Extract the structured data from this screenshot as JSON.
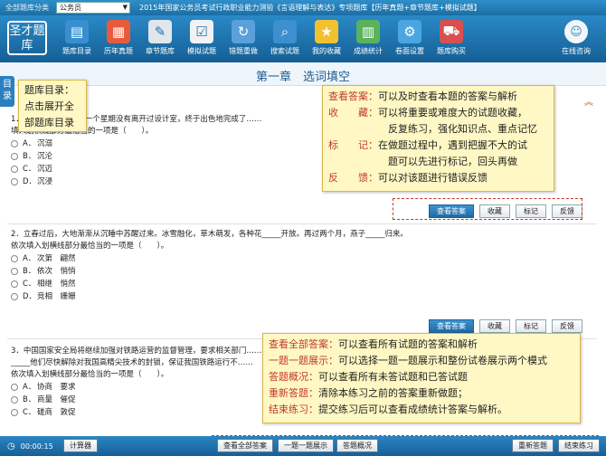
{
  "topbar": {
    "category_label": "全部题库分类",
    "category_value": "公务员",
    "title": "2015年国家公务员考试行政职业能力测验《言语理解与表达》专项题库【历年真题+章节题库+模拟试题】"
  },
  "logo": {
    "text": "圣才题库"
  },
  "toolbar": {
    "items": [
      {
        "label": "题库目录",
        "icon": "catalog-icon",
        "color": "#3a8fd0"
      },
      {
        "label": "历年真题",
        "icon": "calendar-icon",
        "color": "#e85b3a"
      },
      {
        "label": "章节题库",
        "icon": "notebook-icon",
        "color": "#e0e6ec"
      },
      {
        "label": "模拟试题",
        "icon": "checklist-icon",
        "color": "#f0f2f4"
      },
      {
        "label": "错题重做",
        "icon": "redo-icon",
        "color": "#5aa0da"
      },
      {
        "label": "搜索试题",
        "icon": "search-icon",
        "color": "#3e8fcf"
      },
      {
        "label": "我的收藏",
        "icon": "star-icon",
        "color": "#f2c12e"
      },
      {
        "label": "成绩统计",
        "icon": "stats-icon",
        "color": "#5ab25a"
      },
      {
        "label": "卷面设置",
        "icon": "gear-icon",
        "color": "#4aa6e0"
      },
      {
        "label": "题库购买",
        "icon": "cart-icon",
        "color": "#d94f4f"
      }
    ],
    "online": {
      "label": "在线咨询",
      "icon": "chat-icon"
    }
  },
  "chapter": {
    "title": "第一章　选词填空",
    "directory_tab": "目录"
  },
  "questions": [
    {
      "stem_lines": [
        "1．在纷繁的世界中，一个星期没有离开过设计室，终于出色地完成了……",
        "填入划横线部分最恰当的一项是（　　）。"
      ],
      "options": [
        {
          "letter": "A．",
          "text": "沉溺"
        },
        {
          "letter": "B．",
          "text": "沉沦"
        },
        {
          "letter": "C．",
          "text": "沉迈"
        },
        {
          "letter": "D．",
          "text": "沉浸"
        }
      ]
    },
    {
      "stem_lines": [
        "2．立春过后，大地渐渐从沉睡中苏醒过来。冰雪融化，草木萌发，各种花_____开放。再过两个月，燕子_____归来。",
        "依次填入划横线部分最恰当的一项是（　　）。"
      ],
      "options": [
        {
          "letter": "A．",
          "text": "次第　翩然"
        },
        {
          "letter": "B．",
          "text": "依次　悄悄"
        },
        {
          "letter": "C．",
          "text": "相继　悄然"
        },
        {
          "letter": "D．",
          "text": "竞相　姗姗"
        }
      ]
    },
    {
      "stem_lines": [
        "3．中国国家安全局将继续加强对铁路运营的监督管理，要求相关部门……",
        "_____他们尽快解除对我国高精尖技术的封锁，保证我国铁路运行不……",
        "依次填入划横线部分最恰当的一项是（　　）。"
      ],
      "options": [
        {
          "letter": "A．",
          "text": "协商　要求"
        },
        {
          "letter": "B．",
          "text": "商量　催促"
        },
        {
          "letter": "C．",
          "text": "磋商　敦促"
        }
      ]
    }
  ],
  "question_actions": [
    "查看答案",
    "收藏",
    "标记",
    "反馈"
  ],
  "callouts": {
    "directory": [
      "题库目录：",
      "点击展开全",
      "部题库目录"
    ],
    "answer": [
      {
        "key": "查看答案：",
        "text": "可以及时查看本题的答案与解析"
      },
      {
        "key": "收　　藏：",
        "text": "可以将重要或难度大的试题收藏，"
      },
      {
        "key": "",
        "text": "反复练习，强化知识点、重点记忆"
      },
      {
        "key": "标　　记：",
        "text": "在做题过程中，遇到把握不大的试"
      },
      {
        "key": "",
        "text": "题可以先进行标记，回头再做"
      },
      {
        "key": "反　　馈：",
        "text": "可以对该题进行错误反馈"
      }
    ],
    "footer": [
      {
        "key": "查看全部答案：",
        "text": "可以查看所有试题的答案和解析"
      },
      {
        "key": "一题一题展示：",
        "text": "可以选择一题一题展示和整份试卷展示两个模式"
      },
      {
        "key": "答题概况：",
        "text": "可以查看所有未答试题和已答试题"
      },
      {
        "key": "重新答题：",
        "text": "清除本练习之前的答案重新做题；"
      },
      {
        "key": "结束练习：",
        "text": "提交练习后可以查看成绩统计答案与解析。"
      }
    ]
  },
  "footer": {
    "time": "00:00:15",
    "calculator": "计算器",
    "view_all": "查看全部答案",
    "one_by_one": "一题一题展示",
    "overview": "答题概况",
    "restart": "重新答题",
    "finish": "结束练习"
  }
}
